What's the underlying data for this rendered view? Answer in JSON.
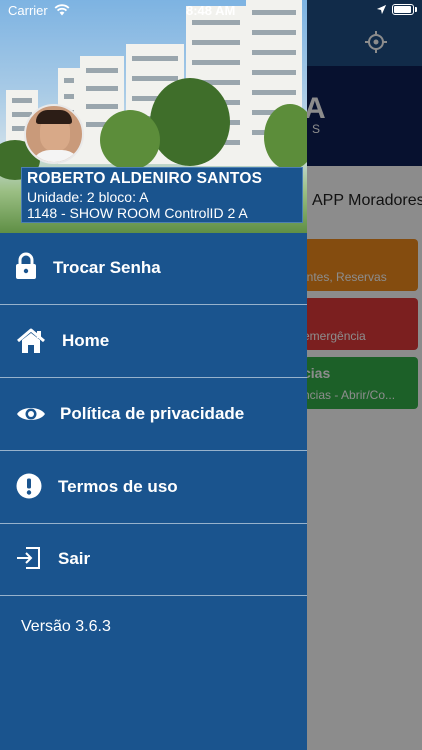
{
  "status_bar": {
    "carrier": "Carrier",
    "time": "8:48 AM",
    "battery_level": 0.95
  },
  "background_app": {
    "logo_letter": "A",
    "logo_sub": "S",
    "greeting": "APP Moradores",
    "cards": [
      {
        "title": "o",
        "subtitle": "sitantes, Reservas",
        "color": "#f08a1c"
      },
      {
        "title": "",
        "subtitle": "emergência",
        "color": "#e03a3a"
      },
      {
        "title": "cias",
        "subtitle": "ncias - Abrir/Co...",
        "color": "#33b04a"
      }
    ]
  },
  "user": {
    "name": "ROBERTO ALDENIRO SANTOS",
    "unit": "Unidade: 2 bloco: A",
    "condominium": "1148 - SHOW ROOM ControlID 2 A"
  },
  "menu": {
    "items": [
      {
        "label": "Trocar Senha",
        "icon": "lock-icon"
      },
      {
        "label": "Home",
        "icon": "home-icon"
      },
      {
        "label": "Política de privacidade",
        "icon": "eye-icon"
      },
      {
        "label": "Termos de uso",
        "icon": "alert-circle-icon"
      },
      {
        "label": "Sair",
        "icon": "sign-out-icon"
      }
    ]
  },
  "version": "Versão 3.6.3",
  "colors": {
    "drawer": "#1a548e",
    "nav": "#1f4f86",
    "banner": "#0d1f57"
  }
}
